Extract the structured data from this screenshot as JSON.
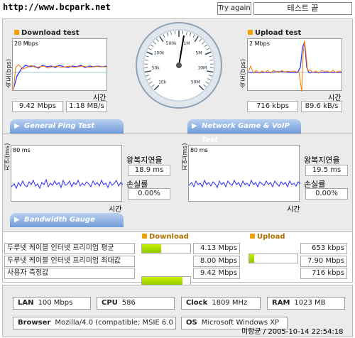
{
  "top": {
    "url": "http://www.bcpark.net",
    "retry_label": "Try again",
    "status_label": "테스트 끝"
  },
  "download": {
    "title": "Download test",
    "yaxis": "속도(bps)",
    "scale": "20 Mbps",
    "xlabel": "시간",
    "mbps": "9.42 Mbps",
    "mbs": "1.18 MB/s"
  },
  "upload": {
    "title": "Upload test",
    "yaxis": "속도(bps)",
    "scale": "2 Mbps",
    "xlabel": "시간",
    "kbps": "716 kbps",
    "kbs": "89.6 kB/s"
  },
  "ping": {
    "header": "General Ping Test",
    "yaxis": "지연(ms)",
    "scale": "80 ms",
    "xlabel": "시간",
    "rtt_label": "왕복지연율",
    "rtt": "18.9 ms",
    "loss_label": "손실률",
    "loss": "0.00%"
  },
  "voip": {
    "header": "Network Game & VoIP Test",
    "yaxis": "지연(ms)",
    "scale": "80 ms",
    "xlabel": "시간",
    "rtt_label": "왕복지연율",
    "rtt": "19.5 ms",
    "loss_label": "손실률",
    "loss": "0.00%"
  },
  "gauge": {
    "ticks": [
      "10k",
      "50k",
      "100k",
      "500k",
      "1M",
      "5M",
      "10M",
      "50M"
    ],
    "needle_value": "9.42 Mbps"
  },
  "bandwidth": {
    "header": "Bandwidth Gauge",
    "download_label": "Download",
    "upload_label": "Upload",
    "rows": [
      {
        "label": "두루넷 케이블 인터넷 프리미엄 평균",
        "dl": "4.13 Mbps",
        "dl_pct": 0.4,
        "ul": "653 kbps",
        "ul_pct": 0.1
      },
      {
        "label": "두루넷 케이블 인터넷 프리미엄 최대값",
        "dl": "8.00 Mbps",
        "dl_pct": 0.84,
        "ul": "7.90 Mbps",
        "ul_pct": 0.99
      },
      {
        "label": "사용자 측정값",
        "dl": "9.42 Mbps",
        "dl_pct": 1.0,
        "ul": "716 kbps",
        "ul_pct": 0.1
      }
    ]
  },
  "info": {
    "lan_label": "LAN",
    "lan": "100 Mbps",
    "cpu_label": "CPU",
    "cpu": "586",
    "clock_label": "Clock",
    "clock": "1809 MHz",
    "ram_label": "RAM",
    "ram": "1023 MB",
    "browser_label": "Browser",
    "browser": "Mozilla/4.0 (compatible; MSIE 6.0",
    "os_label": "OS",
    "os": "Microsoft Windows XP"
  },
  "footer": {
    "stamp": "미랑균 / 2005-10-14 22:54:18"
  }
}
